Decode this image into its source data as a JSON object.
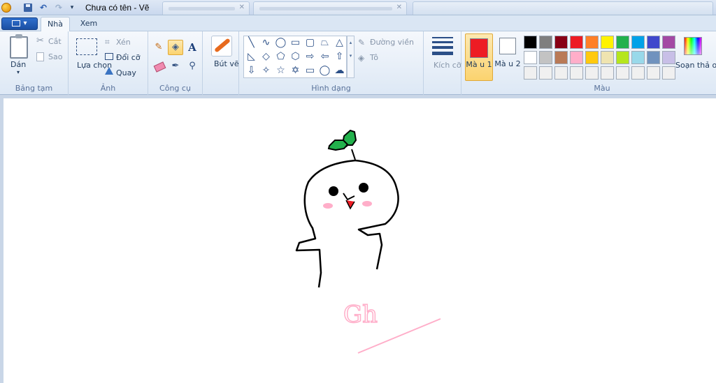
{
  "titlebar": {
    "title": "Chưa có tên - Vẽ",
    "undo_icon": "undo-icon",
    "redo_icon": "redo-icon"
  },
  "tabs": {
    "file": "",
    "home": "Nhà",
    "view": "Xem"
  },
  "clipboard": {
    "paste": "Dán",
    "cut": "Cắt",
    "copy": "Sao",
    "group": "Bảng tạm"
  },
  "image": {
    "select": "Lựa chọn",
    "crop": "Xén",
    "resize": "Đổi cỡ",
    "rotate": "Quay",
    "group": "Ảnh"
  },
  "tools": {
    "group": "Công cụ",
    "selected": "fill-icon",
    "text_glyph": "A"
  },
  "brush": {
    "label": "Bút vẽ"
  },
  "shapes": {
    "group": "Hình dạng",
    "outline": "Đường viền",
    "fill": "Tô",
    "glyphs": [
      "╲",
      "∿",
      "◯",
      "▭",
      "▢",
      "⏢",
      "△",
      "◺",
      "◇",
      "⬠",
      "⬡",
      "⇨",
      "⇦",
      "⇧",
      "⇩",
      "✧",
      "☆",
      "✡",
      "▭",
      "◯",
      "☁"
    ]
  },
  "size": {
    "label": "Kích cỡ"
  },
  "colors": {
    "group": "Màu",
    "color1": "Mà u 1",
    "color2": "Mà u 2",
    "color1_value": "#ed1c24",
    "color2_value": "#ffffff",
    "edit": "Soạn thả o màu",
    "palette_row1": [
      "#000000",
      "#7f7f7f",
      "#880015",
      "#ed1c24",
      "#ff7f27",
      "#fff200",
      "#22b14c",
      "#00a2e8",
      "#3f48cc",
      "#a349a4"
    ],
    "palette_row2": [
      "#ffffff",
      "#c3c3c3",
      "#b97a57",
      "#ffaec9",
      "#ffc90e",
      "#efe4b0",
      "#b5e61d",
      "#99d9ea",
      "#7092be",
      "#c8bfe7"
    ],
    "palette_row3": [
      "#f0f0f0",
      "#f0f0f0",
      "#f0f0f0",
      "#f0f0f0",
      "#f0f0f0",
      "#f0f0f0",
      "#f0f0f0",
      "#f0f0f0",
      "#f0f0f0",
      "#f0f0f0"
    ]
  },
  "canvas": {
    "handwriting": "Gh"
  }
}
